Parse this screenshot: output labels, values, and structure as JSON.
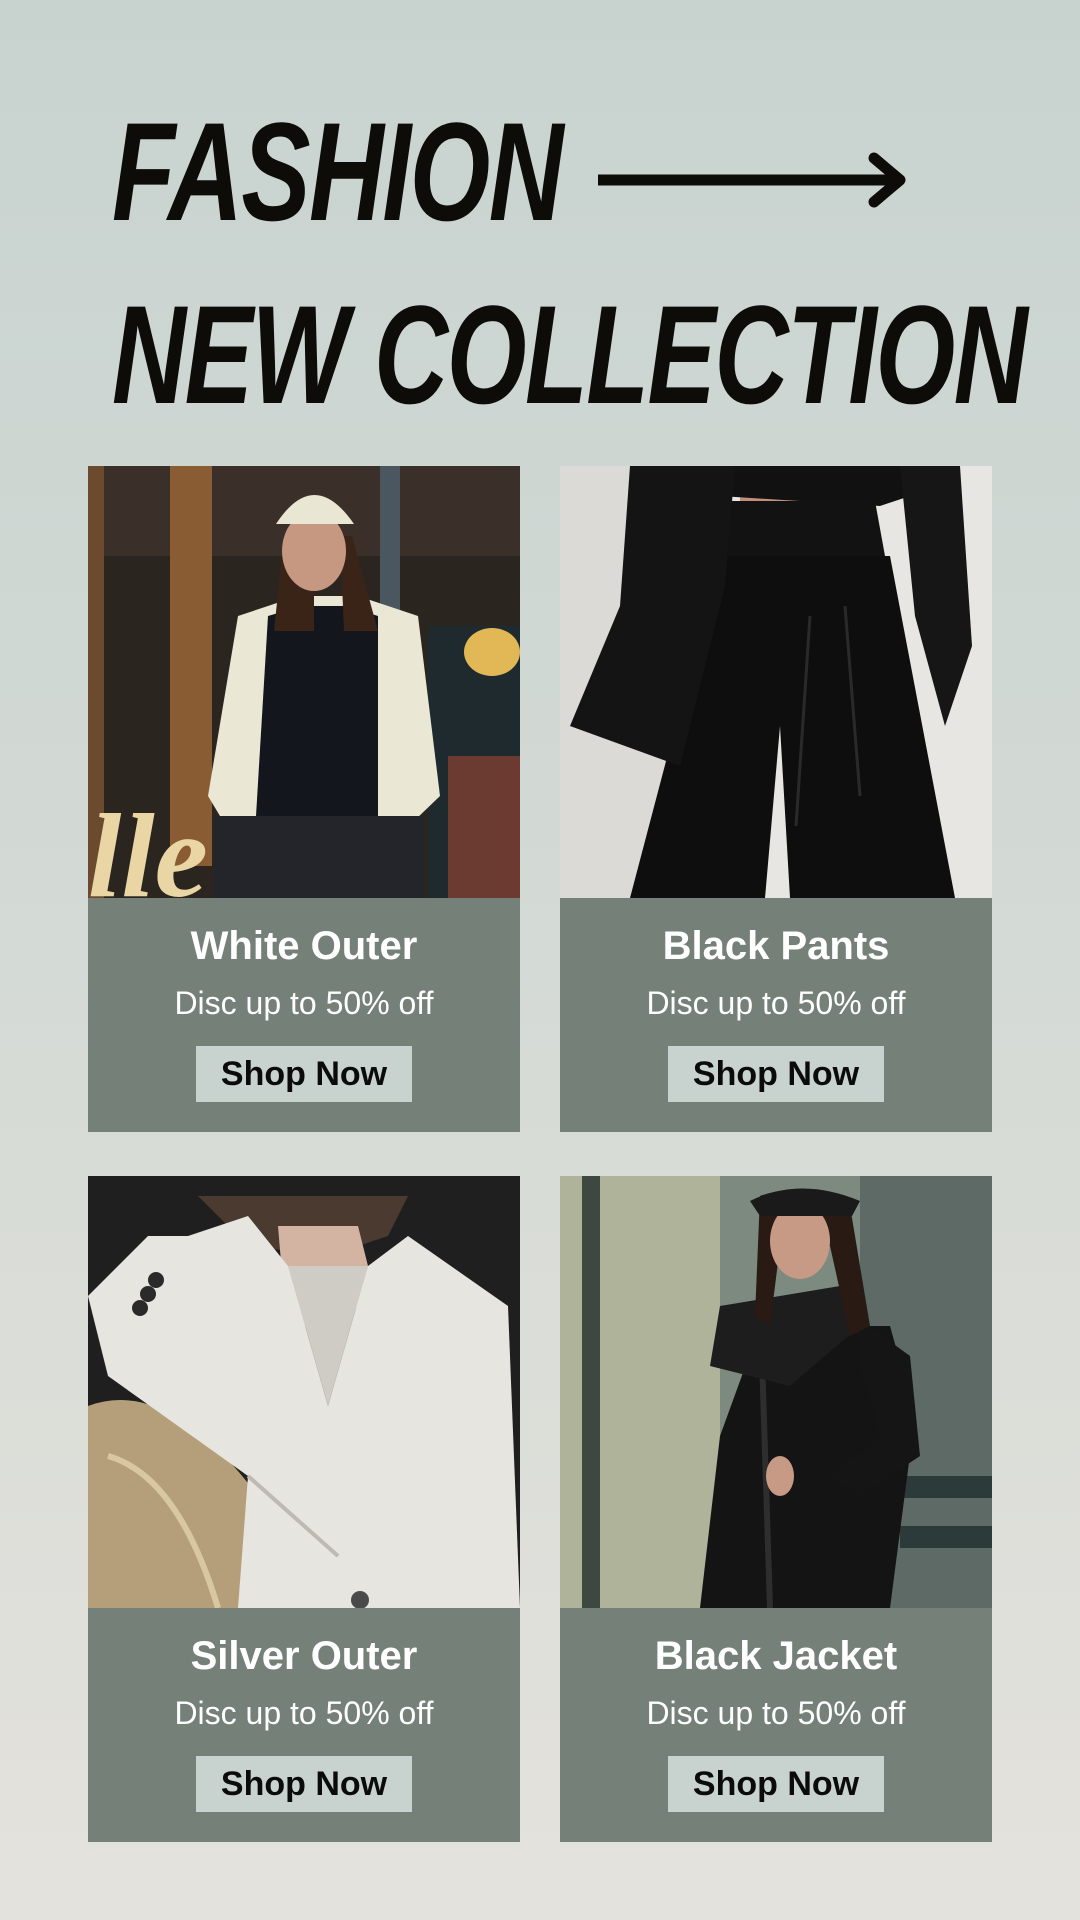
{
  "header": {
    "line1": "FASHION",
    "line2": "NEW COLLECTION",
    "arrow_icon": "arrow-right-icon"
  },
  "colors": {
    "background_top": "#c8d3d0",
    "background_bottom": "#e4e2dc",
    "headline": "#0e0c08",
    "card_panel": "#758079",
    "button": "#c8d3d0",
    "button_text": "#0b0b0b"
  },
  "products": [
    {
      "name": "White Outer",
      "discount": "Disc up to 50% off",
      "button": "Shop Now"
    },
    {
      "name": "Black Pants",
      "discount": "Disc up to 50% off",
      "button": "Shop Now"
    },
    {
      "name": "Silver Outer",
      "discount": "Disc up to 50% off",
      "button": "Shop Now"
    },
    {
      "name": "Black Jacket",
      "discount": "Disc up to 50% off",
      "button": "Shop Now"
    }
  ]
}
